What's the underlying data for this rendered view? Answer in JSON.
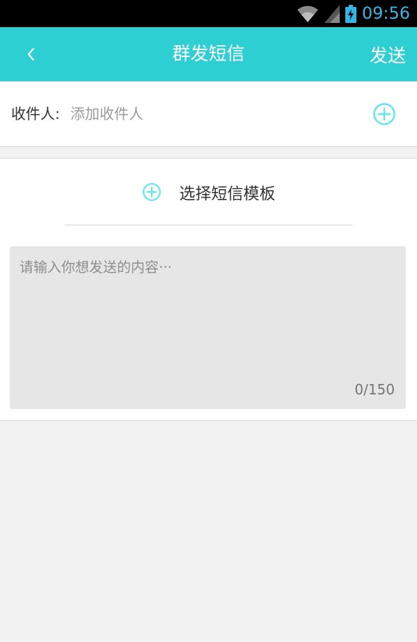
{
  "status_bar": {
    "time": "09:56",
    "icons": [
      "wifi-icon",
      "signal-icon",
      "battery-charging-icon"
    ]
  },
  "app_bar": {
    "back_icon": "chevron-left-icon",
    "title": "群发短信",
    "send_label": "发送",
    "background_color": "#2dcfd3"
  },
  "recipient": {
    "label": "收件人:",
    "placeholder": "添加收件人",
    "value": "",
    "add_icon": "plus-circle-icon"
  },
  "template": {
    "label": "选择短信模板",
    "icon": "plus-circle-icon"
  },
  "message": {
    "placeholder": "请输入你想发送的内容···",
    "value": "",
    "counter": "0/150"
  },
  "colors": {
    "accent": "#2dcfd3",
    "icon_accent": "#5ce8ee",
    "status_blue": "#33b5e5"
  }
}
